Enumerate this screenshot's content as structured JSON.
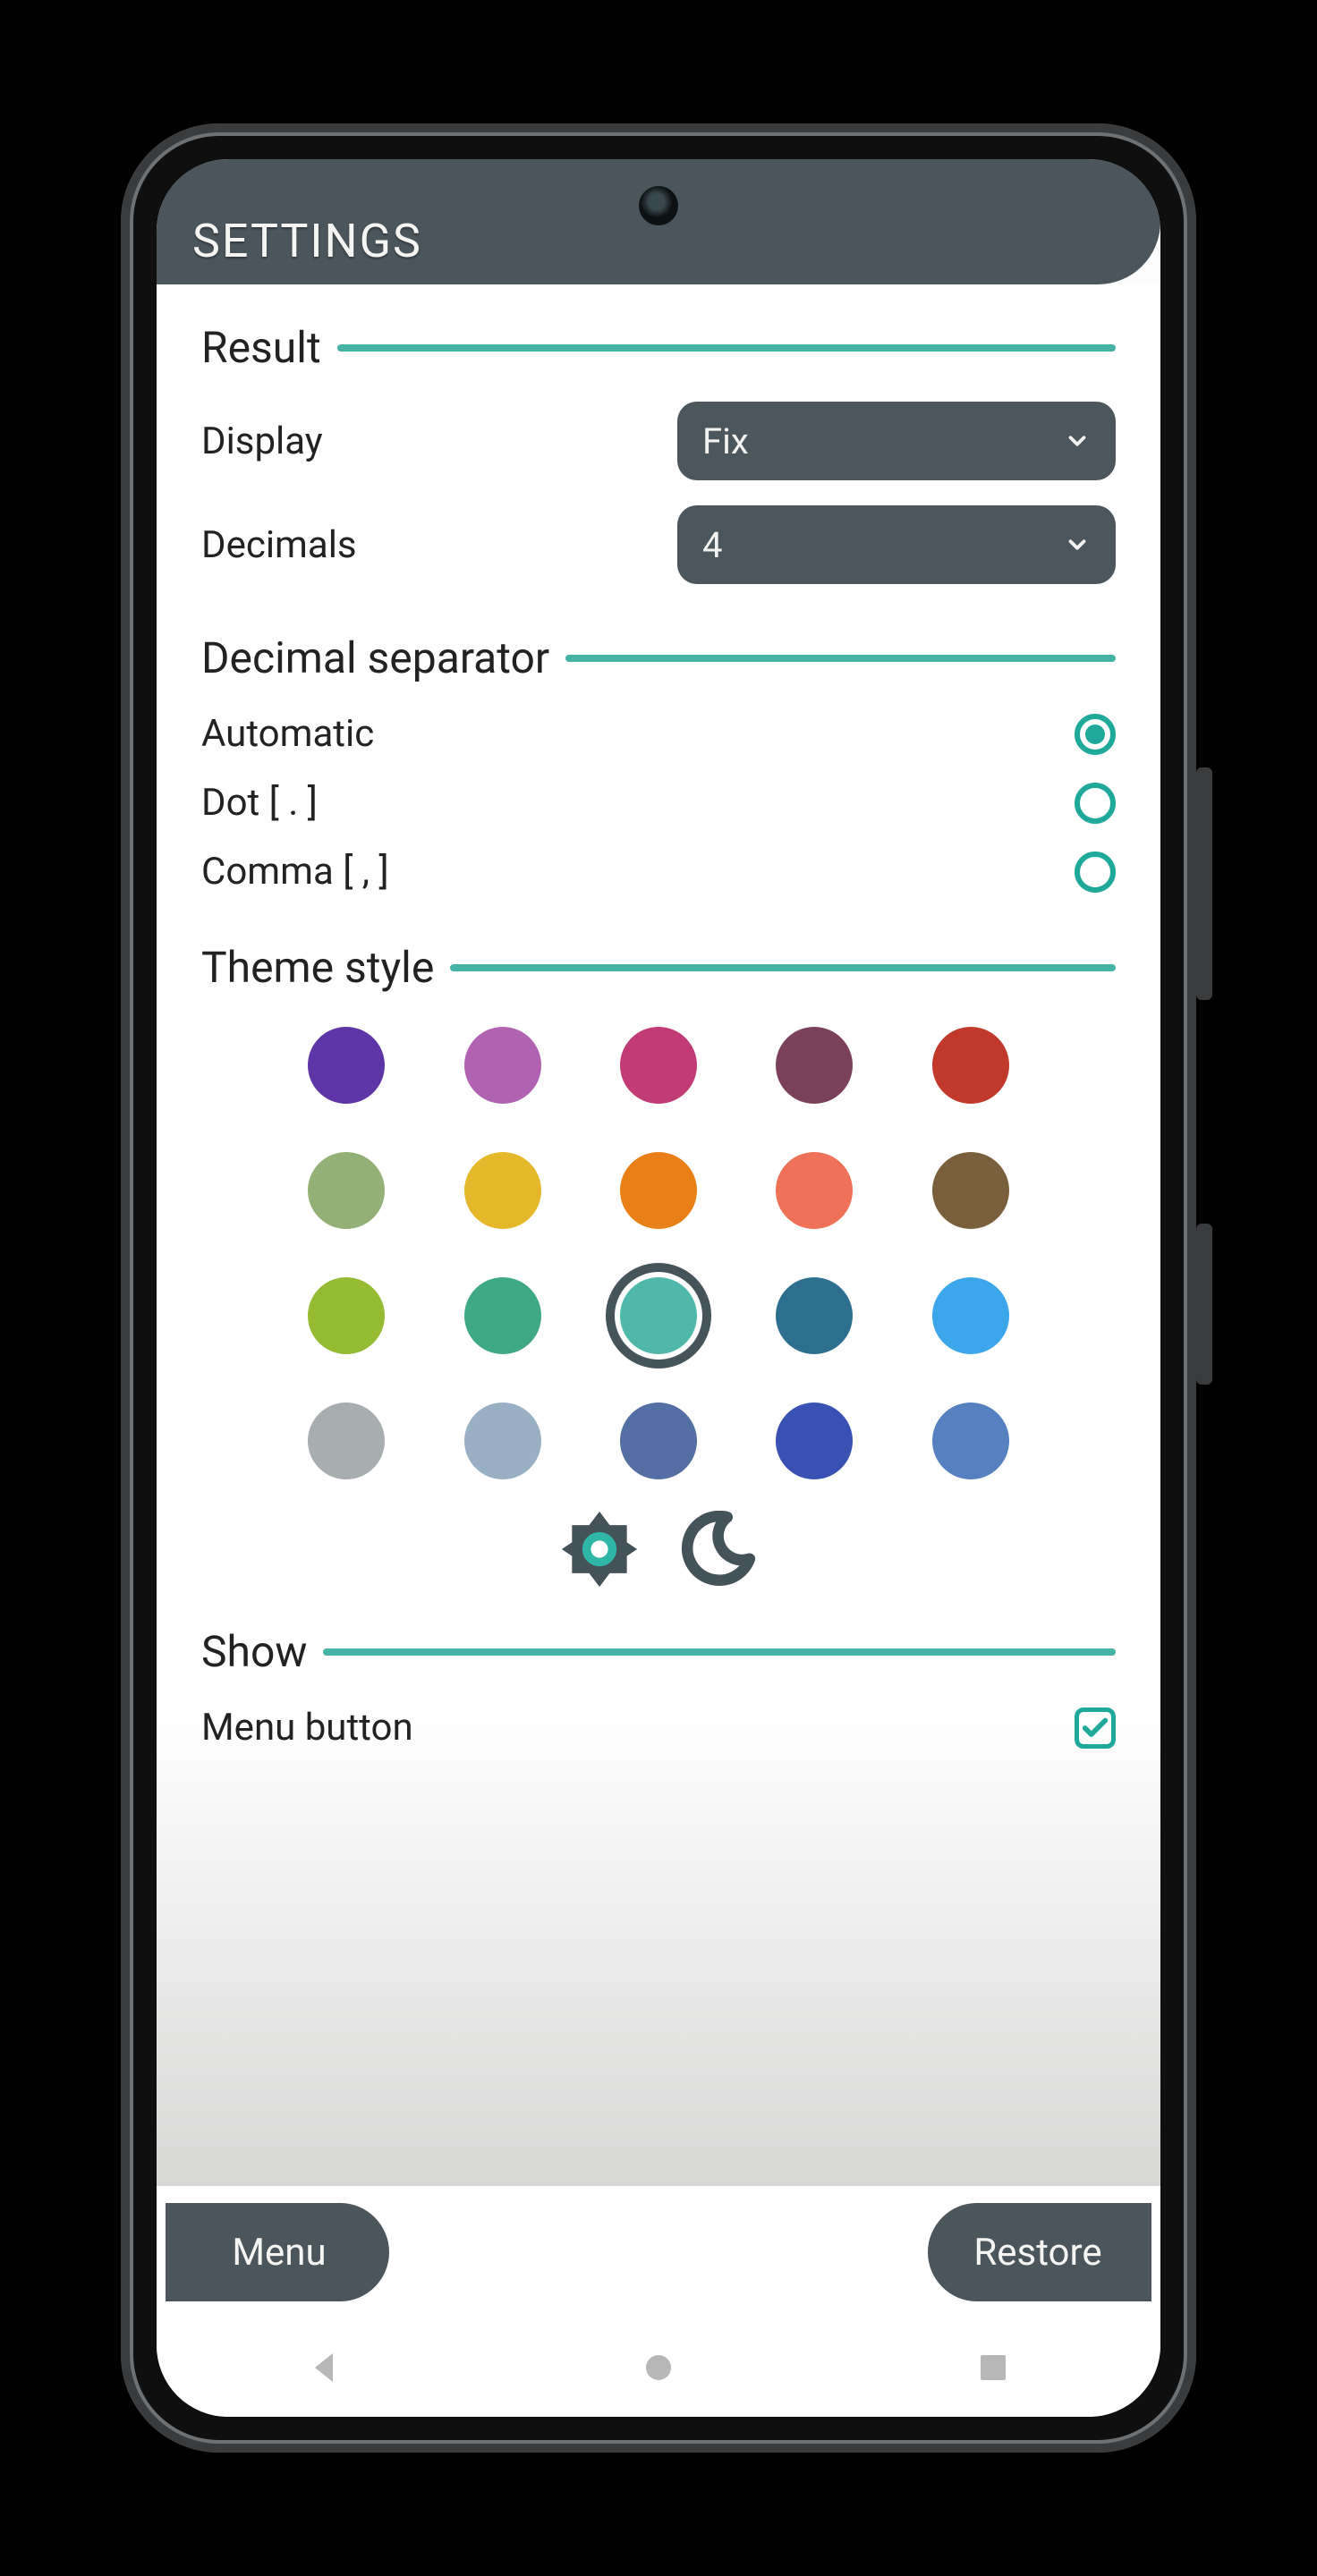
{
  "accent": "#45b3a5",
  "header": {
    "title": "SETTINGS"
  },
  "sections": {
    "result": {
      "title": "Result",
      "display_label": "Display",
      "display_value": "Fix",
      "decimals_label": "Decimals",
      "decimals_value": "4"
    },
    "separator": {
      "title": "Decimal separator",
      "options": [
        {
          "label": "Automatic",
          "selected": true
        },
        {
          "label": "Dot [ . ]",
          "selected": false
        },
        {
          "label": "Comma [ , ]",
          "selected": false
        }
      ]
    },
    "theme": {
      "title": "Theme style",
      "colors": [
        "#5e35a6",
        "#b162b2",
        "#c23a76",
        "#7b415b",
        "#c0392b",
        "#93b177",
        "#e4b82a",
        "#e98017",
        "#ee7158",
        "#7a5f3d",
        "#94bb32",
        "#3fa986",
        "#4fb8aa",
        "#2d6f8e",
        "#3ba6ea",
        "#a8adaf",
        "#99b0c4",
        "#546fa3",
        "#3a51b4",
        "#5680c0"
      ],
      "selected_index": 12,
      "mode": "light"
    },
    "show": {
      "title": "Show",
      "menu_button_label": "Menu button",
      "menu_button_checked": true
    }
  },
  "footer": {
    "menu": "Menu",
    "restore": "Restore"
  }
}
